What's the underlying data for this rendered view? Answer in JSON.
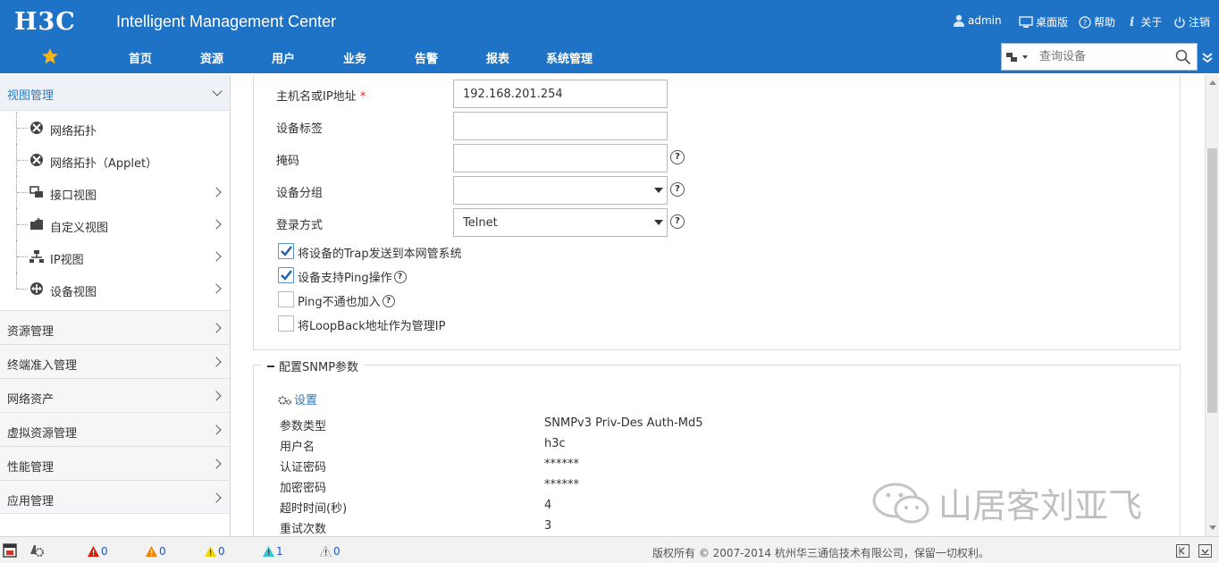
{
  "header": {
    "logo": "H3C",
    "title": "Intelligent Management Center",
    "user": "admin",
    "desktop": "桌面版",
    "help": "帮助",
    "about": "关于",
    "logout": "注销",
    "nav": [
      "首页",
      "资源",
      "用户",
      "业务",
      "告警",
      "报表",
      "系统管理"
    ],
    "search_placeholder": "查询设备"
  },
  "sidebar": {
    "header": "视图管理",
    "items": [
      {
        "label": "网络拓扑",
        "icon": "topology-icon"
      },
      {
        "label": "网络拓扑（Applet）",
        "icon": "topology-icon"
      },
      {
        "label": "接口视图",
        "icon": "interface-icon"
      },
      {
        "label": "自定义视图",
        "icon": "custom-view-icon"
      },
      {
        "label": "IP视图",
        "icon": "ip-view-icon"
      },
      {
        "label": "设备视图",
        "icon": "device-icon"
      }
    ],
    "sections": [
      "资源管理",
      "终端准入管理",
      "网络资产",
      "虚拟资源管理",
      "性能管理",
      "应用管理"
    ]
  },
  "form": {
    "host_label": "主机名或IP地址",
    "host_required": "*",
    "host_value": "192.168.201.254",
    "device_tag_label": "设备标签",
    "device_tag_value": "",
    "mask_label": "掩码",
    "mask_value": "",
    "group_label": "设备分组",
    "group_value": "",
    "login_label": "登录方式",
    "login_value": "Telnet",
    "checkboxes": [
      {
        "label": "将设备的Trap发送到本网管系统",
        "checked": true,
        "help": false
      },
      {
        "label": "设备支持Ping操作",
        "checked": true,
        "help": true
      },
      {
        "label": "Ping不通也加入",
        "checked": false,
        "help": true
      },
      {
        "label": "将LoopBack地址作为管理IP",
        "checked": false,
        "help": false
      }
    ]
  },
  "snmp": {
    "legend": "配置SNMP参数",
    "settings": "设置",
    "params": [
      {
        "label": "参数类型",
        "value": "SNMPv3 Priv-Des Auth-Md5"
      },
      {
        "label": "用户名",
        "value": "h3c"
      },
      {
        "label": "认证密码",
        "value": "******"
      },
      {
        "label": "加密密码",
        "value": "******"
      },
      {
        "label": "超时时间(秒)",
        "value": "4"
      },
      {
        "label": "重试次数",
        "value": "3"
      }
    ]
  },
  "footer": {
    "alarms": [
      {
        "count": "0",
        "color": "#d81e06"
      },
      {
        "count": "0",
        "color": "#f08300"
      },
      {
        "count": "0",
        "color": "#f2d600"
      },
      {
        "count": "1",
        "color": "#36c6d3"
      },
      {
        "count": "0",
        "color": "#eeeeee"
      }
    ],
    "copyright": "版权所有 © 2007-2014 杭州华三通信技术有限公司，保留一切权利。"
  },
  "watermark": "山居客刘亚飞"
}
